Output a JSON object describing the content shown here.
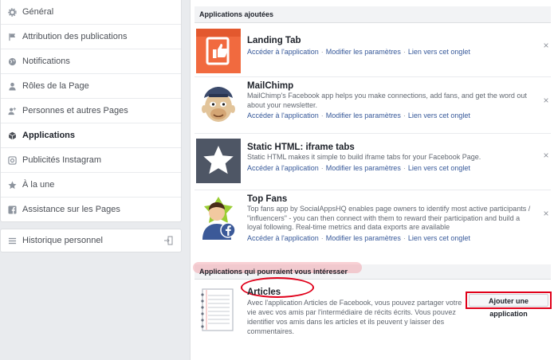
{
  "sidebar": {
    "items": [
      {
        "label": "Général",
        "icon": "gear-icon",
        "active": false
      },
      {
        "label": "Attribution des publications",
        "icon": "flag-icon",
        "active": false
      },
      {
        "label": "Notifications",
        "icon": "globe-icon",
        "active": false
      },
      {
        "label": "Rôles de la Page",
        "icon": "person-icon",
        "active": false
      },
      {
        "label": "Personnes et autres Pages",
        "icon": "people-icon",
        "active": false
      },
      {
        "label": "Applications",
        "icon": "cube-icon",
        "active": true
      },
      {
        "label": "Publicités Instagram",
        "icon": "instagram-icon",
        "active": false
      },
      {
        "label": "À la une",
        "icon": "star-icon",
        "active": false
      },
      {
        "label": "Assistance sur les Pages",
        "icon": "facebook-icon",
        "active": false
      }
    ],
    "history": {
      "label": "Historique personnel",
      "icon": "list-icon"
    }
  },
  "added": {
    "heading": "Applications ajoutées",
    "apps": [
      {
        "name": "Landing Tab",
        "desc": "",
        "links": [
          "Accéder à l'application",
          "Modifier les paramètres",
          "Lien vers cet onglet"
        ]
      },
      {
        "name": "MailChimp",
        "desc": "MailChimp's Facebook app helps you make connections, add fans, and get the word out about your newsletter.",
        "links": [
          "Accéder à l'application",
          "Modifier les paramètres",
          "Lien vers cet onglet"
        ]
      },
      {
        "name": "Static HTML: iframe tabs",
        "desc": "Static HTML makes it simple to build iframe tabs for your Facebook Page.",
        "links": [
          "Accéder à l'application",
          "Modifier les paramètres",
          "Lien vers cet onglet"
        ]
      },
      {
        "name": "Top Fans",
        "desc": "Top fans app by SocialAppsHQ enables page owners to identify most active participants / \"influencers\" - you can then connect with them to reward their participation and build a loyal following. Real-time metrics and data exports are available",
        "links": [
          "Accéder à l'application",
          "Modifier les paramètres",
          "Lien vers cet onglet"
        ]
      }
    ],
    "close": "×",
    "sep": "·"
  },
  "suggested": {
    "heading": "Applications qui pourraient vous intéresser",
    "app": {
      "name": "Articles",
      "desc": "Avec l'application Articles de Facebook, vous pouvez partager votre vie avec vos amis par l'intermédiaire de récits écrits. Vous pouvez identifier vos amis dans les articles et ils peuvent y laisser des commentaires.",
      "button": "Ajouter une application"
    }
  },
  "colors": {
    "link": "#365899",
    "highlight": "#e0001a",
    "landing": "#f16a3f",
    "static": "#4e5665"
  }
}
